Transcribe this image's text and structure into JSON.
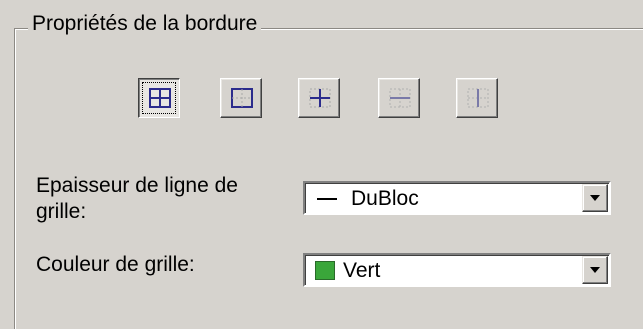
{
  "group": {
    "title": "Propriétés de la bordure"
  },
  "toolbar": {
    "buttons": [
      {
        "icon": "all-borders-icon",
        "selected": true
      },
      {
        "icon": "outside-borders-icon",
        "selected": false
      },
      {
        "icon": "inside-borders-icon",
        "selected": false
      },
      {
        "icon": "inside-horizontal-borders-icon",
        "selected": false
      },
      {
        "icon": "inside-vertical-borders-icon",
        "selected": false
      }
    ]
  },
  "line_thickness": {
    "label": "Epaisseur de ligne de grille:",
    "value": "DuBloc"
  },
  "grid_color": {
    "label": "Couleur de grille:",
    "value": "Vert",
    "color": "#3aa63a"
  }
}
